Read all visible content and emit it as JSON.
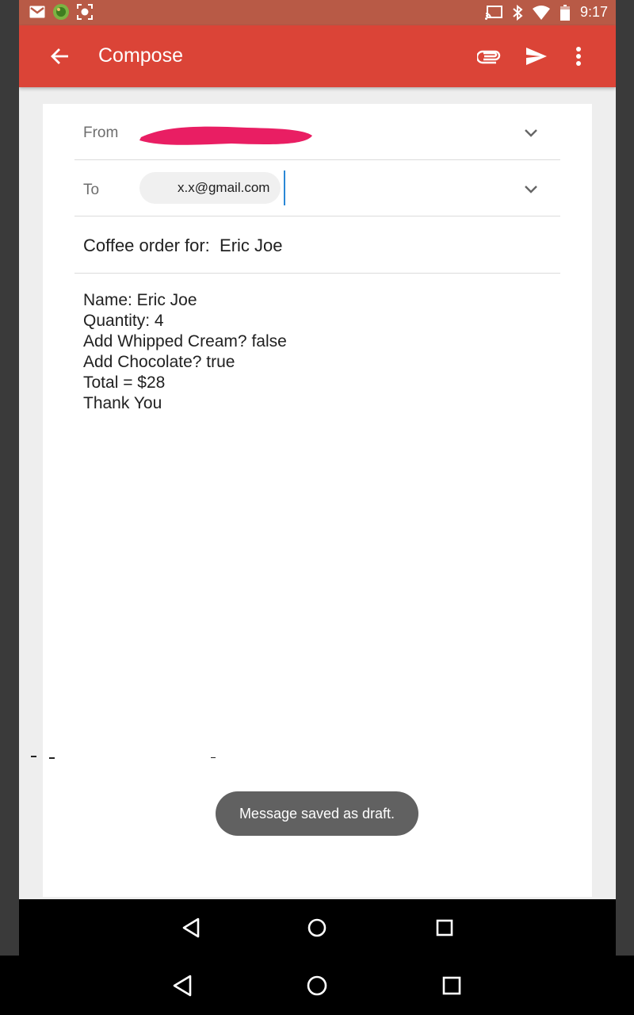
{
  "status_bar": {
    "time": "9:17",
    "left_icons": [
      "gmail-icon",
      "android-icon",
      "screenshot-icon"
    ],
    "right_icons": [
      "cast-icon",
      "bluetooth-icon",
      "wifi-icon",
      "battery-icon"
    ]
  },
  "app_bar": {
    "title": "Compose",
    "color": "#db4437",
    "actions": [
      "attach-icon",
      "send-icon",
      "more-icon"
    ]
  },
  "compose": {
    "from_label": "From",
    "to_label": "To",
    "to_recipient": "x.x@gmail.com",
    "subject": "Coffee order for:  Eric Joe",
    "body_lines": [
      "Name: Eric Joe",
      "Quantity: 4",
      "Add Whipped Cream? false",
      "Add Chocolate? true",
      "Total = $28",
      "Thank You"
    ]
  },
  "snackbar": {
    "message": "Message saved as draft."
  },
  "nav_bar": {
    "buttons": [
      "back-icon",
      "home-icon",
      "recents-icon"
    ]
  }
}
